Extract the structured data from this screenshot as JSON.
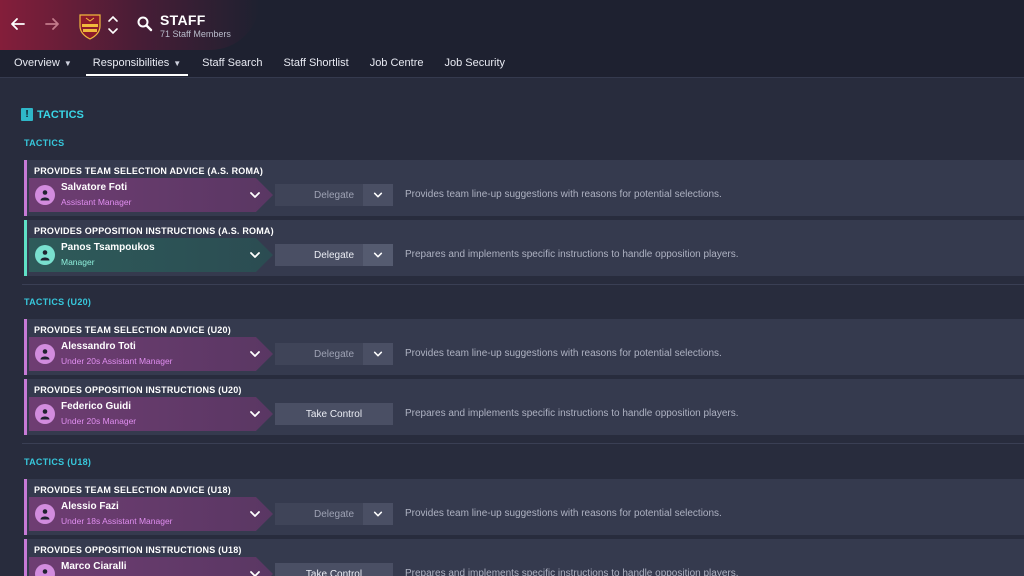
{
  "header": {
    "title": "STAFF",
    "subtitle": "71 Staff Members",
    "tabs": [
      {
        "label": "Overview",
        "has_dropdown": true,
        "active": false
      },
      {
        "label": "Responsibilities",
        "has_dropdown": true,
        "active": true
      },
      {
        "label": "Staff Search",
        "has_dropdown": false,
        "active": false
      },
      {
        "label": "Staff Shortlist",
        "has_dropdown": false,
        "active": false
      },
      {
        "label": "Job Centre",
        "has_dropdown": false,
        "active": false
      },
      {
        "label": "Job Security",
        "has_dropdown": false,
        "active": false
      }
    ]
  },
  "section": {
    "title": "TACTICS",
    "icon": "exclamation-icon"
  },
  "colors": {
    "accent_cyan": "#3ad6e6",
    "purple_role": "#e08ef0",
    "teal_role": "#8ff0dc",
    "purple_bar": "#c77ad6",
    "teal_bar": "#5fe0c6"
  },
  "groups": [
    {
      "label": "TACTICS",
      "items": [
        {
          "title": "PROVIDES TEAM SELECTION ADVICE (A.S. ROMA)",
          "staff_name": "Salvatore Foti",
          "staff_role": "Assistant Manager",
          "theme": "purple",
          "action": "delegate",
          "action_label": "Delegate",
          "enabled": false,
          "description": "Provides team line-up suggestions with reasons for potential selections."
        },
        {
          "title": "PROVIDES OPPOSITION INSTRUCTIONS (A.S. ROMA)",
          "staff_name": "Panos Tsampoukos",
          "staff_role": "Manager",
          "theme": "teal",
          "action": "delegate",
          "action_label": "Delegate",
          "enabled": true,
          "description": "Prepares and implements specific instructions to handle opposition players."
        }
      ]
    },
    {
      "label": "TACTICS (U20)",
      "items": [
        {
          "title": "PROVIDES TEAM SELECTION ADVICE (U20)",
          "staff_name": "Alessandro Toti",
          "staff_role": "Under 20s Assistant Manager",
          "theme": "purple",
          "action": "delegate",
          "action_label": "Delegate",
          "enabled": false,
          "description": "Provides team line-up suggestions with reasons for potential selections."
        },
        {
          "title": "PROVIDES OPPOSITION INSTRUCTIONS (U20)",
          "staff_name": "Federico Guidi",
          "staff_role": "Under 20s Manager",
          "theme": "purple",
          "action": "take_control",
          "action_label": "Take Control",
          "enabled": true,
          "description": "Prepares and implements specific instructions to handle opposition players."
        }
      ]
    },
    {
      "label": "TACTICS (U18)",
      "items": [
        {
          "title": "PROVIDES TEAM SELECTION ADVICE (U18)",
          "staff_name": "Alessio Fazi",
          "staff_role": "Under 18s Assistant Manager",
          "theme": "purple",
          "action": "delegate",
          "action_label": "Delegate",
          "enabled": false,
          "description": "Provides team line-up suggestions with reasons for potential selections."
        },
        {
          "title": "PROVIDES OPPOSITION INSTRUCTIONS (U18)",
          "staff_name": "Marco Ciaralli",
          "staff_role": "",
          "theme": "purple",
          "action": "take_control",
          "action_label": "Take Control",
          "enabled": true,
          "description": "Prepares and implements specific instructions to handle opposition players."
        }
      ]
    }
  ]
}
